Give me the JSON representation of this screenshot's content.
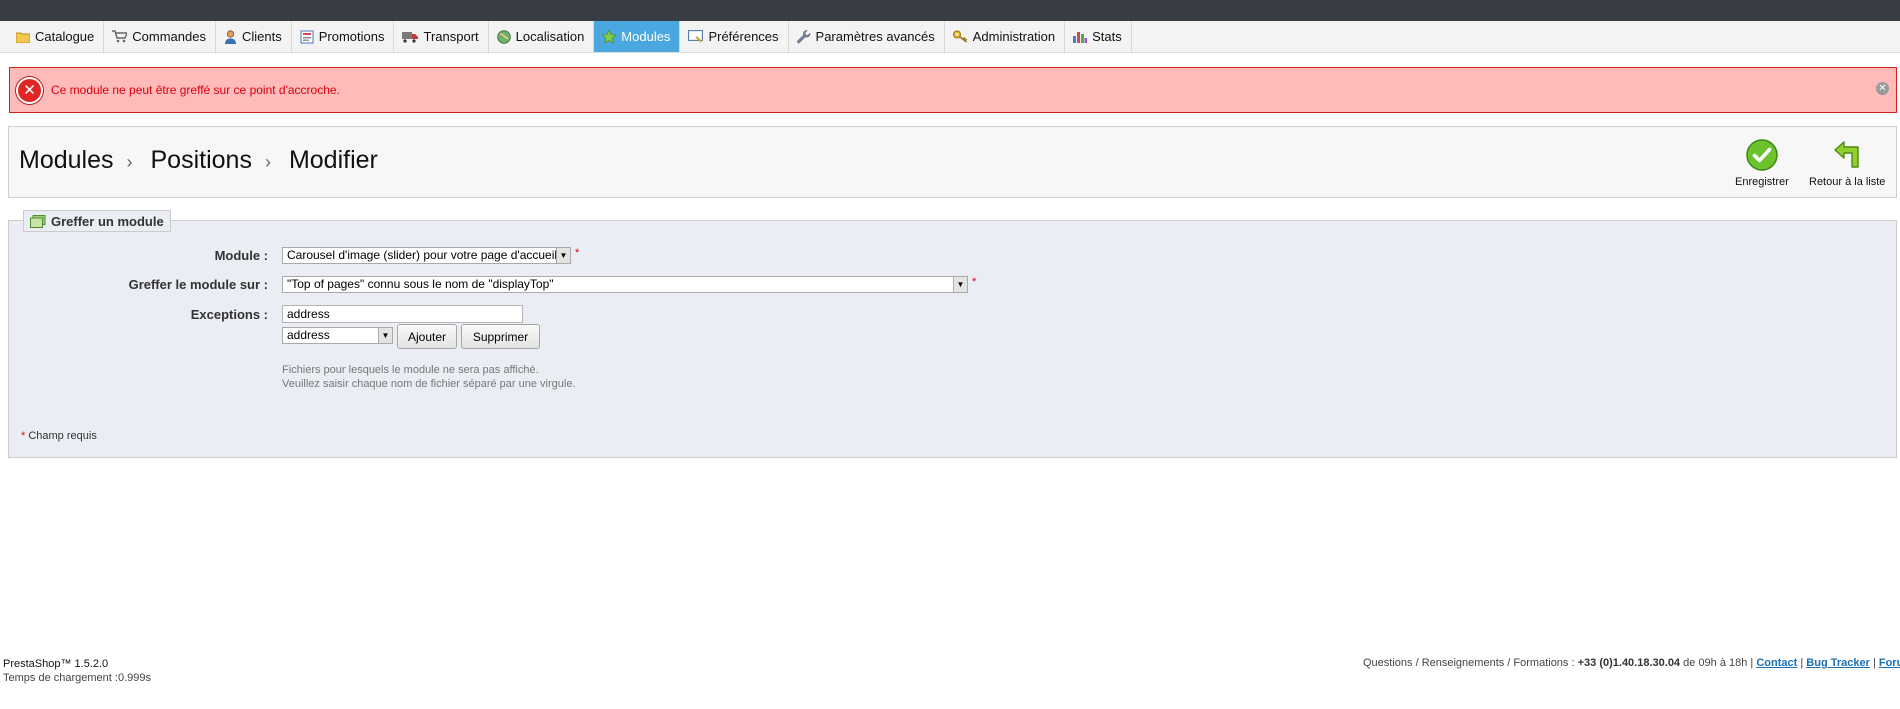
{
  "nav": {
    "items": [
      {
        "label": "Catalogue",
        "icon": "folder-icon",
        "active": false
      },
      {
        "label": "Commandes",
        "icon": "cart-icon",
        "active": false
      },
      {
        "label": "Clients",
        "icon": "user-icon",
        "active": false
      },
      {
        "label": "Promotions",
        "icon": "promotions-icon",
        "active": false
      },
      {
        "label": "Transport",
        "icon": "truck-icon",
        "active": false
      },
      {
        "label": "Localisation",
        "icon": "globe-icon",
        "active": false
      },
      {
        "label": "Modules",
        "icon": "puzzle-icon",
        "active": true
      },
      {
        "label": "Préférences",
        "icon": "preferences-icon",
        "active": false
      },
      {
        "label": "Paramètres avancés",
        "icon": "wrench-icon",
        "active": false
      },
      {
        "label": "Administration",
        "icon": "key-icon",
        "active": false
      },
      {
        "label": "Stats",
        "icon": "bar-chart-icon",
        "active": false
      }
    ]
  },
  "alert": {
    "message": "Ce module ne peut être greffé sur ce point d'accroche.",
    "icon": "error-icon",
    "close_icon": "close-icon"
  },
  "breadcrumb": {
    "items": [
      "Modules",
      "Positions",
      "Modifier"
    ],
    "separator": "›"
  },
  "toolbar": {
    "save_label": "Enregistrer",
    "back_label": "Retour à la liste"
  },
  "form": {
    "legend": "Greffer un module",
    "module_label": "Module :",
    "module_value": "Carousel d'image (slider) pour votre page d'accueil",
    "hook_label": "Greffer le module sur :",
    "hook_value": "\"Top of pages\" connu sous le nom de \"displayTop\"",
    "exceptions_label": "Exceptions :",
    "exceptions_value": "address",
    "exceptions_select_value": "address",
    "add_label": "Ajouter",
    "remove_label": "Supprimer",
    "help_line1": "Fichiers pour lesquels le module ne sera pas affiché.",
    "help_line2": "Veuillez saisir chaque nom de fichier séparé par une virgule.",
    "required_star": "*",
    "required_note": "Champ requis"
  },
  "footer": {
    "version": "PrestaShop™ 1.5.2.0",
    "load_time": "Temps de chargement :0.999s",
    "contact_prefix": "Questions / Renseignements / Formations :",
    "phone": "+33 (0)1.40.18.30.04",
    "hours": "de 09h à 18h",
    "sep": "|",
    "link_contact": "Contact",
    "link_bugtracker": "Bug Tracker",
    "link_forum": "Forum"
  },
  "colors": {
    "topbar": "#383d45",
    "active_tab": "#4aa7e0",
    "alert_bg": "#ffbaba",
    "alert_text": "#d8000c",
    "form_bg": "#ebedf4"
  }
}
